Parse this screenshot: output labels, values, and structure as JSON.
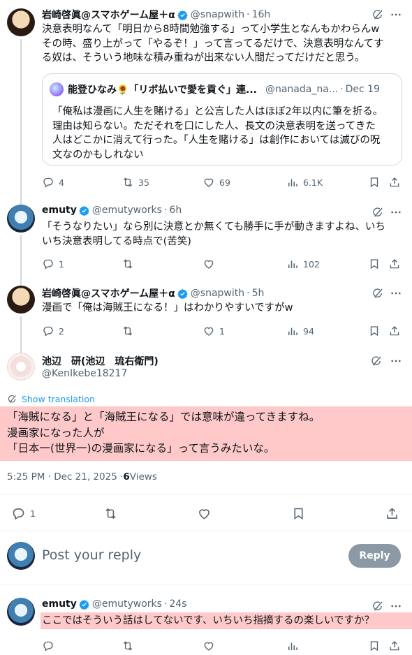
{
  "tweet1": {
    "name": "岩崎啓眞@スマホゲーム屋＋α",
    "handle": "@snapwith",
    "time": "16h",
    "lines": [
      "決意表明なんて「明日から8時間勉強する」って小学生となんもかわらんw",
      "その時、盛り上がって「やるぞ！」って言ってるだけで、決意表明なんてす",
      "る奴は、そういう地味な積み重ねが出来ない人間だってだけだと思う。"
    ],
    "quote": {
      "name": "能登ひなみ🌻「リボ払いで愛を貢ぐ」連...",
      "handle": "@nanada_na...",
      "time": "Dec 19",
      "lines": [
        "「俺私は漫画に人生を賭ける」と公言した人はほぼ2年以内に筆を折る。",
        "理由は知らない。ただそれを口にした人、長文の決意表明を送ってきた",
        "人はどこかに消えて行った。「人生を賭ける」は創作においては滅びの呪",
        "文なのかもしれない"
      ]
    },
    "stats": {
      "replies": "4",
      "reposts": "35",
      "likes": "69",
      "views": "6.1K"
    }
  },
  "tweet2": {
    "name": "emuty",
    "handle": "@emutyworks",
    "time": "6h",
    "lines": [
      "「そうなりたい」なら別に決意とか無くても勝手に手が動きますよね、いち",
      "いち決意表明してる時点で(苦笑)"
    ],
    "stats": {
      "replies": "1",
      "reposts": "",
      "likes": "",
      "views": "102"
    }
  },
  "tweet3": {
    "name": "岩崎啓眞@スマホゲーム屋＋α",
    "handle": "@snapwith",
    "time": "5h",
    "lines": [
      "漫画で「俺は海賊王になる！」はわかりやすいですがw"
    ],
    "stats": {
      "replies": "2",
      "reposts": "",
      "likes": "1",
      "views": "94"
    }
  },
  "main": {
    "name": "池辺　研(池辺　琉右衛門)",
    "handle": "@KenIkebe18217",
    "show_translation": "Show translation",
    "lines": [
      "「海賊になる」と「海賊王になる」では意味が違ってきますね。",
      "漫画家になった人が",
      "「日本一(世界一)の漫画家になる」って言うみたいな。"
    ],
    "timestamp": "5:25 PM · Dec 21, 2025 · ",
    "views_count": "6",
    "views_label": " Views",
    "replies": "1"
  },
  "composer": {
    "placeholder": "Post your reply",
    "button": "Reply"
  },
  "tweet4": {
    "name": "emuty",
    "handle": "@emutyworks",
    "time": "24s",
    "lines": [
      "ここではそういう話はしてないです、いちいち指摘するの楽しいですか？"
    ]
  },
  "colors": {
    "accent": "#1d9bf0",
    "muted": "#536471",
    "highlight": "#ffc9c9"
  }
}
